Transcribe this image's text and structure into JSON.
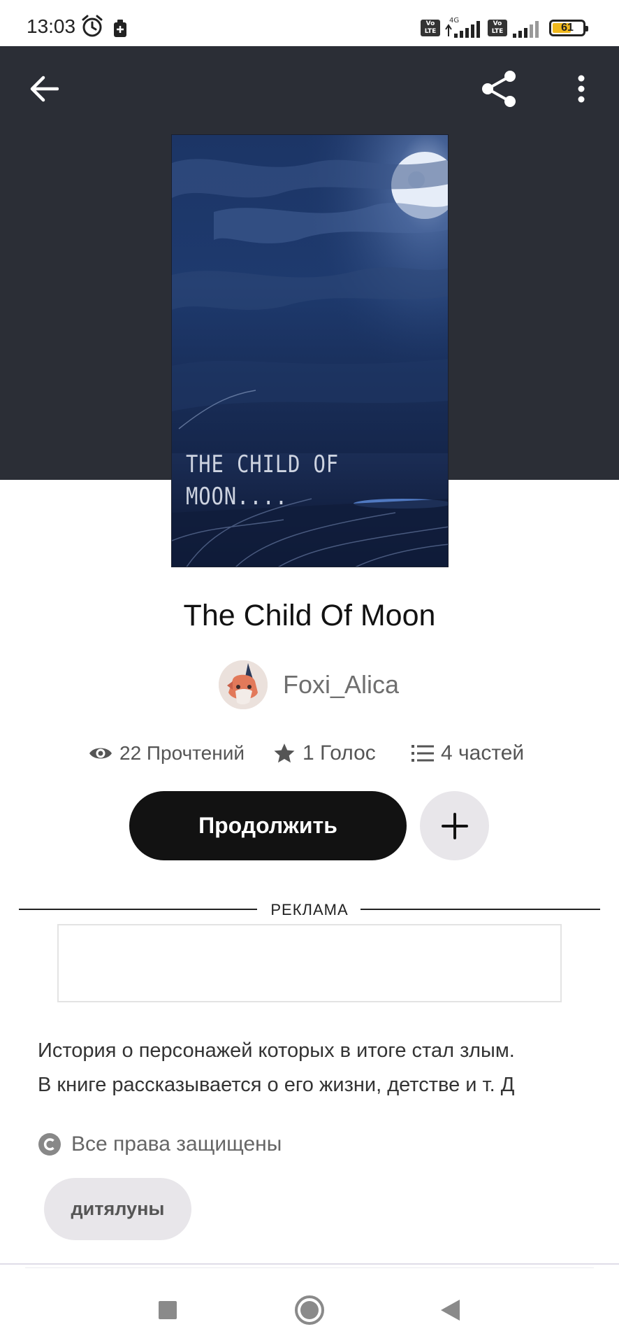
{
  "status_bar": {
    "time": "13:03",
    "lte_label": "Vo LTE",
    "network_label": "4G",
    "battery_level": 61,
    "battery_text": "61"
  },
  "toolbar": {
    "back_icon": "arrow-left-icon",
    "share_icon": "share-icon",
    "more_icon": "more-vertical-icon"
  },
  "book": {
    "cover_text_line1": "THE CHILD OF",
    "cover_text_line2": "MOON....",
    "title": "The Child Of Moon",
    "author": "Foxi_Alica",
    "stats": {
      "reads": "22 Прочтений",
      "votes": "1 Голос",
      "parts": "4 частей"
    },
    "continue_label": "Продолжить",
    "description_line1": "История о персонажей которых в итоге стал злым.",
    "description_line2": "В книге рассказывается о его жизни, детстве и т. Д",
    "rights": "Все права защищены",
    "tag": "дитялуны"
  },
  "ad": {
    "label": "РЕКЛАМА"
  },
  "colors": {
    "hero_bg": "#2b2e36",
    "primary_button": "#121212",
    "secondary_button": "#e8e6ea",
    "battery": "#f0b81c"
  }
}
